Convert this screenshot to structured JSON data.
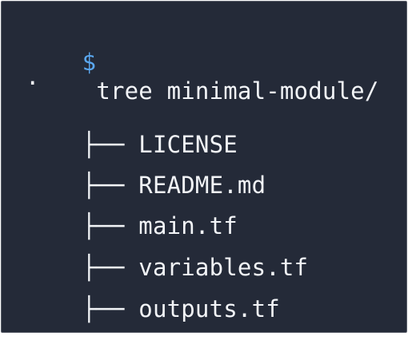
{
  "terminal": {
    "prompt_symbol": "$",
    "command": "tree minimal-module/",
    "root_marker": ".",
    "branch_glyph": "├──",
    "entries": [
      {
        "name": "LICENSE"
      },
      {
        "name": "README.md"
      },
      {
        "name": "main.tf"
      },
      {
        "name": "variables.tf"
      },
      {
        "name": "outputs.tf"
      }
    ]
  },
  "colors": {
    "background": "#242a38",
    "text": "#f2f4f7",
    "prompt": "#5aa7f0"
  }
}
